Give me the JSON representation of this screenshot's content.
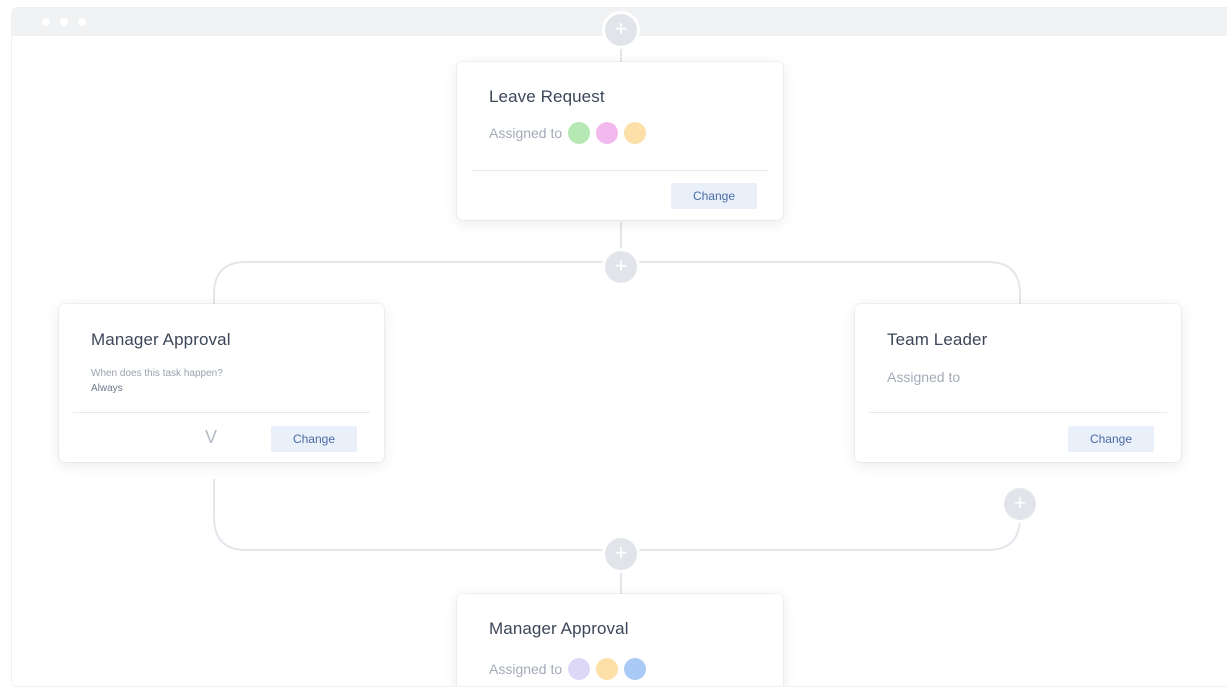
{
  "colors": {
    "connector": "#e3e6ea",
    "plus_bg": "#e1e4e9",
    "button_bg": "#eaf0fa",
    "button_text": "#4a6aa3",
    "title_text": "#3c4759"
  },
  "cards": {
    "leave_request": {
      "title": "Leave Request",
      "assigned_label": "Assigned to",
      "avatars": [
        "#b5e8b3",
        "#f2b9ee",
        "#fde0a8"
      ],
      "button": "Change"
    },
    "manager_approval_left": {
      "title": "Manager Approval",
      "question": "When does this task happen?",
      "answer": "Always",
      "chevron": "V",
      "button": "Change"
    },
    "team_leader": {
      "title": "Team Leader",
      "assigned_label": "Assigned to",
      "button": "Change"
    },
    "manager_approval_bottom": {
      "title": "Manager Approval",
      "assigned_label": "Assigned to",
      "avatars": [
        "#dcd8f6",
        "#fde0a8",
        "#a9c9f6"
      ]
    }
  },
  "plus_symbol": "+",
  "icons": [
    "plus-icon",
    "chevron-down-icon"
  ]
}
